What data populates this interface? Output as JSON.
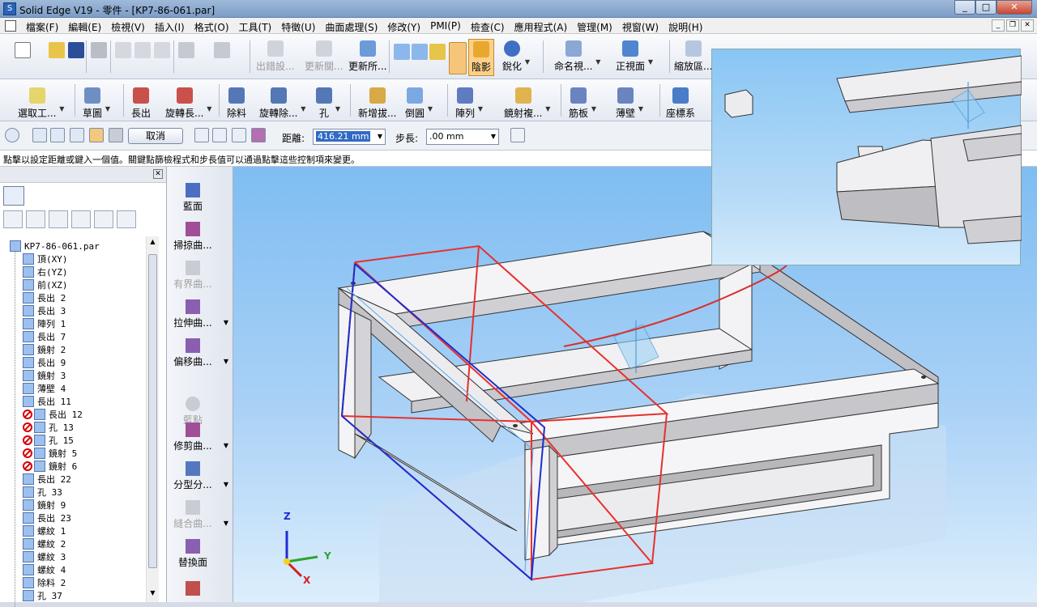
{
  "window": {
    "title": "Solid Edge V19 - 零件 - [KP7-86-061.par]",
    "controls": [
      "_",
      "□",
      "✕"
    ]
  },
  "menu": [
    "檔案(F)",
    "編輯(E)",
    "檢視(V)",
    "插入(I)",
    "格式(O)",
    "工具(T)",
    "特徵(U)",
    "曲面處理(S)",
    "修改(Y)",
    "PMI(P)",
    "檢查(C)",
    "應用程式(A)",
    "管理(M)",
    "視窗(W)",
    "說明(H)"
  ],
  "toolbar1": {
    "buttons": [
      "出錯設...",
      "更新關...",
      "更新所...",
      "陰影",
      "銳化",
      "命名視...",
      "正視面",
      "縮放區..."
    ]
  },
  "toolbar2": {
    "buttons": [
      "選取工...",
      "草圖",
      "長出",
      "旋轉長...",
      "除料",
      "旋轉除...",
      "孔",
      "新增拔...",
      "倒圓",
      "陣列",
      "鏡射複...",
      "筋板",
      "薄壁",
      "座標系"
    ]
  },
  "command_bar": {
    "cancel": "取消",
    "distance_label": "距離:",
    "distance_value": "416.21 mm",
    "step_label": "步長:",
    "step_value": ".00 mm"
  },
  "prompt": "點擊以設定距離或鍵入一個值。關鍵點篩檢程式和步長值可以通過點擊這些控制項來變更。",
  "pathfinder": {
    "root": "KP7-86-061.par",
    "items": [
      {
        "label": "頂(XY)",
        "suppressed": false
      },
      {
        "label": "右(YZ)",
        "suppressed": false
      },
      {
        "label": "前(XZ)",
        "suppressed": false
      },
      {
        "label": "長出 2",
        "suppressed": false
      },
      {
        "label": "長出 3",
        "suppressed": false
      },
      {
        "label": "陣列 1",
        "suppressed": false
      },
      {
        "label": "長出 7",
        "suppressed": false
      },
      {
        "label": "鏡射 2",
        "suppressed": false
      },
      {
        "label": "長出 9",
        "suppressed": false
      },
      {
        "label": "鏡射 3",
        "suppressed": false
      },
      {
        "label": "薄壁 4",
        "suppressed": false
      },
      {
        "label": "長出 11",
        "suppressed": false
      },
      {
        "label": "長出 12",
        "suppressed": true
      },
      {
        "label": "孔 13",
        "suppressed": true
      },
      {
        "label": "孔 15",
        "suppressed": true
      },
      {
        "label": "鏡射 5",
        "suppressed": true
      },
      {
        "label": "鏡射 6",
        "suppressed": true
      },
      {
        "label": "長出 22",
        "suppressed": false
      },
      {
        "label": "孔 33",
        "suppressed": false
      },
      {
        "label": "鏡射 9",
        "suppressed": false
      },
      {
        "label": "長出 23",
        "suppressed": false
      },
      {
        "label": "螺紋 1",
        "suppressed": false
      },
      {
        "label": "螺紋 2",
        "suppressed": false
      },
      {
        "label": "螺紋 3",
        "suppressed": false
      },
      {
        "label": "螺紋 4",
        "suppressed": false
      },
      {
        "label": "除料 2",
        "suppressed": false
      },
      {
        "label": "孔 37",
        "suppressed": false
      }
    ]
  },
  "ribbon": [
    "藍面",
    "掃掠曲...",
    "有界曲...",
    "拉伸曲...",
    "偏移曲...",
    "藍點",
    "修剪曲...",
    "分型分...",
    "縫合曲...",
    "替換面"
  ],
  "axis": {
    "x": "X",
    "y": "Y",
    "z": "Z"
  },
  "colors": {
    "viewport_top": "#7fbdf2",
    "viewport_bottom": "#ddeefc",
    "selection_box": "#e8302e",
    "edge_highlight": "#1c2fd0",
    "annotation": "#d9302a"
  }
}
